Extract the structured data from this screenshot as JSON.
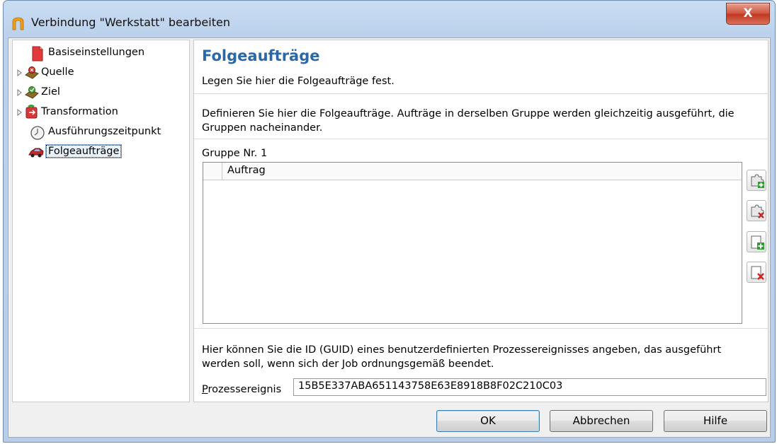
{
  "window": {
    "title": "Verbindung \"Werkstatt\" bearbeiten",
    "close_glyph": "X"
  },
  "tree": {
    "items": [
      {
        "label": "Basiseinstellungen",
        "icon": "document-icon",
        "expandable": false
      },
      {
        "label": "Quelle",
        "icon": "source-icon",
        "expandable": true
      },
      {
        "label": "Ziel",
        "icon": "target-icon",
        "expandable": true
      },
      {
        "label": "Transformation",
        "icon": "transformation-icon",
        "expandable": true
      },
      {
        "label": "Ausführungszeitpunkt",
        "icon": "clock-icon",
        "expandable": false
      },
      {
        "label": "Folgeaufträge",
        "icon": "car-icon",
        "expandable": false,
        "selected": true
      }
    ]
  },
  "panel": {
    "title": "Folgeaufträge",
    "subtitle": "Legen Sie hier die Folgeaufträge fest.",
    "description": "Definieren Sie hier die Folgeaufträge. Aufträge in derselben Gruppe werden gleichzeitig ausgeführt, die Gruppen nacheinander.",
    "group_label": "Gruppe Nr. 1",
    "grid": {
      "columns": [
        "Auftrag"
      ],
      "rows": []
    },
    "tools": [
      {
        "name": "add-job-button",
        "icon": "puzzle-add-icon"
      },
      {
        "name": "remove-job-button",
        "icon": "puzzle-remove-icon"
      },
      {
        "name": "add-group-button",
        "icon": "page-add-icon"
      },
      {
        "name": "remove-group-button",
        "icon": "page-remove-icon"
      }
    ],
    "event_description": "Hier können Sie die ID (GUID) eines benutzerdefinierten Prozessereignisses angeben, das ausgeführt werden soll, wenn sich der Job ordnungsgemäß beendet.",
    "event_label": "Prozessereignis",
    "event_value": "15B5E337ABA651143758E63E8918B8F02C210C03"
  },
  "buttons": {
    "ok": "OK",
    "cancel": "Abbrechen",
    "help": "Hilfe"
  },
  "colors": {
    "title_accent": "#2a68a8",
    "close_red": "#c1361e",
    "titlebar_blue": "#bcd2ec"
  }
}
